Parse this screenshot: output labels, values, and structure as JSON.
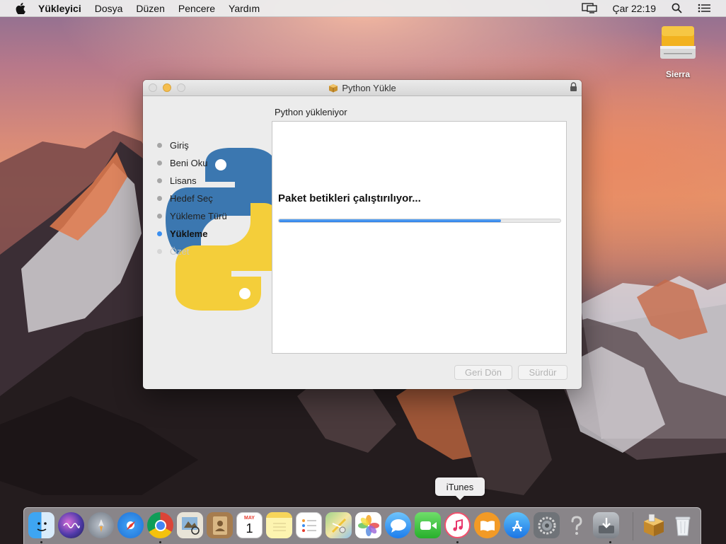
{
  "menubar": {
    "app_name": "Yükleyici",
    "items": [
      "Dosya",
      "Düzen",
      "Pencere",
      "Yardım"
    ],
    "clock": "Çar 22:19"
  },
  "desktop": {
    "drive_label": "Sierra"
  },
  "window": {
    "title": "Python Yükle",
    "heading": "Python yükleniyor",
    "steps": [
      {
        "label": "Giriş",
        "state": "done"
      },
      {
        "label": "Beni Oku",
        "state": "done"
      },
      {
        "label": "Lisans",
        "state": "done"
      },
      {
        "label": "Hedef Seç",
        "state": "done"
      },
      {
        "label": "Yükleme Türü",
        "state": "done"
      },
      {
        "label": "Yükleme",
        "state": "current"
      },
      {
        "label": "Özet",
        "state": "future"
      }
    ],
    "status_text": "Paket betikleri çalıştırılıyor...",
    "progress_percent": 79,
    "back_button": "Geri Dön",
    "continue_button": "Sürdür"
  },
  "dock": {
    "tooltip": "iTunes",
    "items": [
      "Finder",
      "Siri",
      "Launchpad",
      "Safari",
      "Chrome",
      "Preview",
      "Contacts",
      "Calendar",
      "Notes",
      "Reminders",
      "Maps",
      "Photos",
      "Messages",
      "FaceTime",
      "iTunes",
      "iBooks",
      "App Store",
      "System Preferences",
      "Unknown",
      "Downloads",
      "Installer",
      "Trash"
    ],
    "calendar_day": "1",
    "calendar_month": "MAY"
  },
  "colors": {
    "accent": "#3b8ff0",
    "progress": "#3a8aef"
  }
}
